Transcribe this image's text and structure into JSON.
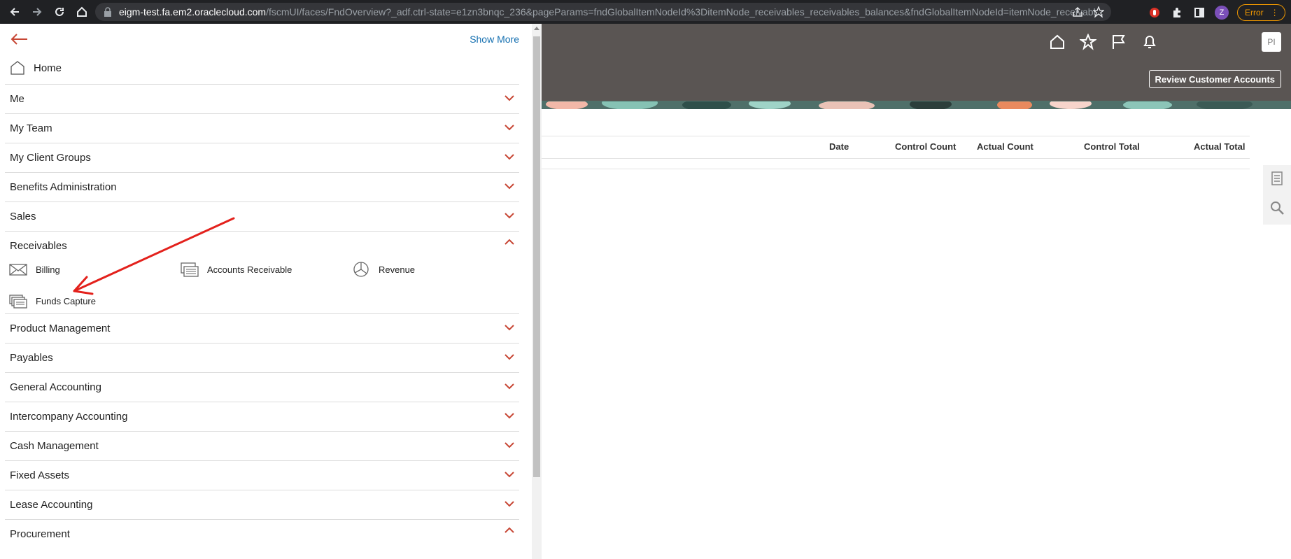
{
  "browser": {
    "url_host": "eigm-test.fa.em2.oraclecloud.com",
    "url_path": "/fscmUI/faces/FndOverview?_adf.ctrl-state=e1zn3bnqc_236&pageParams=fndGlobalItemNodeId%3DitemNode_receivables_receivables_balances&fndGlobalItemNodeId=itemNode_receivabl...",
    "profile_initial": "Z",
    "error_label": "Error"
  },
  "header": {
    "avatar_initials": "PI",
    "review_button": "Review Customer Accounts"
  },
  "table": {
    "columns": [
      "Date",
      "Control Count",
      "Actual Count",
      "Control Total",
      "Actual Total"
    ]
  },
  "navigator": {
    "show_more": "Show More",
    "home": "Home",
    "sections": [
      {
        "label": "Me",
        "expanded": false
      },
      {
        "label": "My Team",
        "expanded": false
      },
      {
        "label": "My Client Groups",
        "expanded": false
      },
      {
        "label": "Benefits Administration",
        "expanded": false
      },
      {
        "label": "Sales",
        "expanded": false
      },
      {
        "label": "Receivables",
        "expanded": true
      },
      {
        "label": "Product Management",
        "expanded": false
      },
      {
        "label": "Payables",
        "expanded": false
      },
      {
        "label": "General Accounting",
        "expanded": false
      },
      {
        "label": "Intercompany Accounting",
        "expanded": false
      },
      {
        "label": "Cash Management",
        "expanded": false
      },
      {
        "label": "Fixed Assets",
        "expanded": false
      },
      {
        "label": "Lease Accounting",
        "expanded": false
      },
      {
        "label": "Procurement",
        "expanded": true
      }
    ],
    "receivables_items": {
      "billing": "Billing",
      "accounts_receivable": "Accounts Receivable",
      "revenue": "Revenue",
      "funds_capture": "Funds Capture"
    }
  },
  "colors": {
    "accent_red": "#c74634",
    "header_bg": "#5a5553",
    "link_blue": "#146fb0"
  }
}
